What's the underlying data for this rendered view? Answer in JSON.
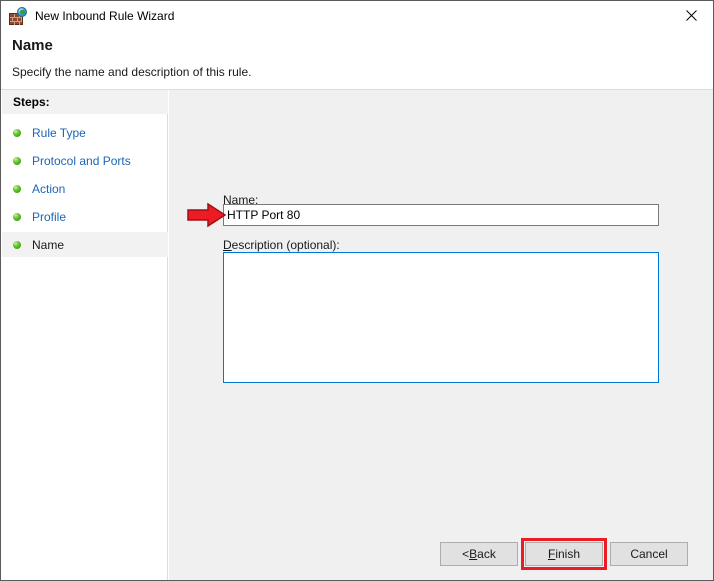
{
  "window": {
    "title": "New Inbound Rule Wizard",
    "icon": "firewall-globe-icon",
    "close_label": "✕"
  },
  "header": {
    "title": "Name",
    "subtitle": "Specify the name and description of this rule."
  },
  "sidebar": {
    "heading": "Steps:",
    "items": [
      {
        "label": "Rule Type",
        "state": "completed"
      },
      {
        "label": "Protocol and Ports",
        "state": "completed"
      },
      {
        "label": "Action",
        "state": "completed"
      },
      {
        "label": "Profile",
        "state": "completed"
      },
      {
        "label": "Name",
        "state": "current"
      }
    ]
  },
  "form": {
    "name_label_accel": "N",
    "name_label_rest": "ame:",
    "name_value": "HTTP Port 80",
    "name_placeholder": "",
    "desc_label_accel": "D",
    "desc_label_rest": "escription (optional):",
    "desc_value": "",
    "desc_placeholder": ""
  },
  "footer": {
    "back_prefix": "< ",
    "back_accel": "B",
    "back_rest": "ack",
    "finish_accel": "F",
    "finish_rest": "inish",
    "cancel_label": "Cancel"
  },
  "annotations": {
    "arrow_color": "#ed1c24",
    "arrow_target": "name-input",
    "highlight_color": "#ed1c24",
    "highlight_target": "finish-button"
  },
  "colors": {
    "window_bg": "#ffffff",
    "panel_bg": "#f0f0f0",
    "link": "#1c66b5",
    "focus_border": "#0078d7",
    "button_face": "#e1e1e1",
    "annotation_red": "#ed1c24",
    "bullet_green": "#5fc427"
  }
}
